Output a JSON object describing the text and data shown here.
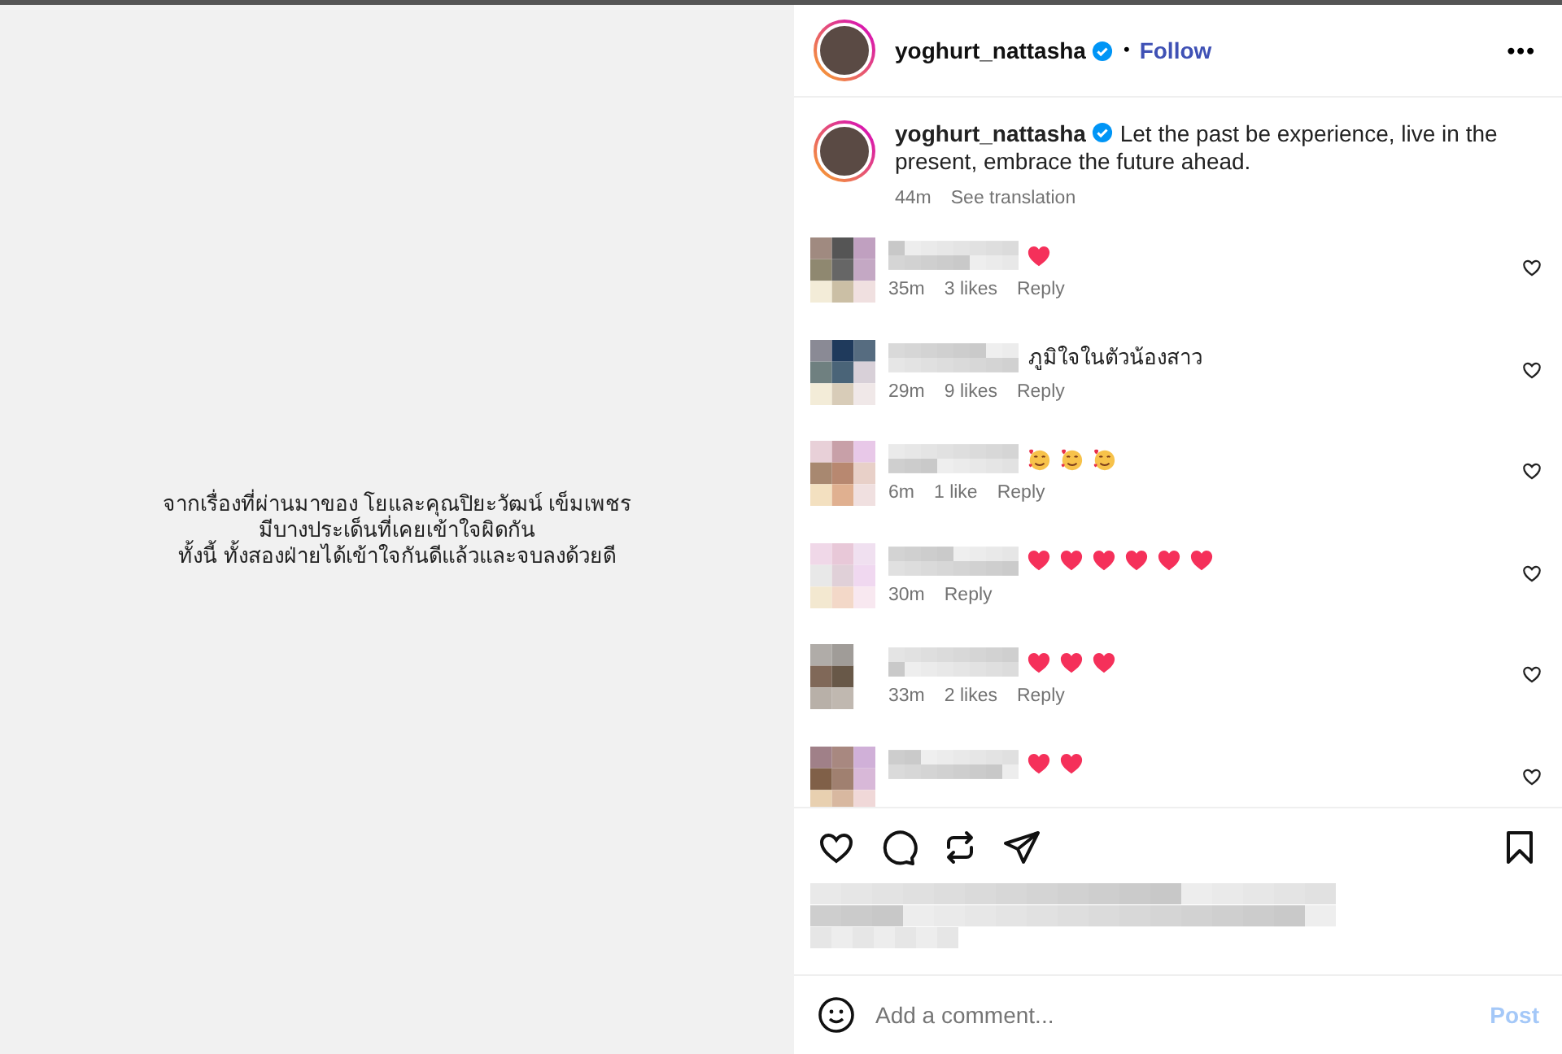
{
  "post_image": {
    "lines": [
      "จากเรื่องที่ผ่านมาของ โยและคุณปิยะวัฒน์ เข็มเพชร",
      "มีบางประเด็นที่เคยเข้าใจผิดกัน",
      "ทั้งนี้ ทั้งสองฝ่ายได้เข้าใจกันดีแล้วและจบลงด้วยดี"
    ]
  },
  "header": {
    "username": "yoghurt_nattasha",
    "verified": true,
    "separator": "•",
    "follow": "Follow",
    "more": "•••"
  },
  "caption": {
    "username": "yoghurt_nattasha",
    "verified": true,
    "text": "Let the past be experience, live in the present, embrace the future ahead.",
    "time": "44m",
    "translate": "See translation"
  },
  "comments": [
    {
      "emojis": [
        {
          "kind": "heart"
        }
      ],
      "time": "35m",
      "likes": "3 likes",
      "reply": "Reply"
    },
    {
      "text": "ภูมิใจในตัวน้องสาว",
      "time": "29m",
      "likes": "9 likes",
      "reply": "Reply"
    },
    {
      "emojis": [
        {
          "kind": "hearts-face"
        },
        {
          "kind": "hearts-face"
        },
        {
          "kind": "hearts-face"
        }
      ],
      "time": "6m",
      "likes": "1 like",
      "reply": "Reply"
    },
    {
      "emojis": [
        {
          "kind": "heart"
        },
        {
          "kind": "heart"
        },
        {
          "kind": "heart"
        },
        {
          "kind": "heart"
        },
        {
          "kind": "heart"
        },
        {
          "kind": "heart"
        }
      ],
      "time": "30m",
      "reply": "Reply"
    },
    {
      "emojis": [
        {
          "kind": "heart"
        },
        {
          "kind": "heart"
        },
        {
          "kind": "heart"
        }
      ],
      "time": "33m",
      "likes": "2 likes",
      "reply": "Reply"
    },
    {
      "emojis": [
        {
          "kind": "heart"
        },
        {
          "kind": "heart"
        }
      ]
    }
  ],
  "add_comment": {
    "placeholder": "Add a comment...",
    "post": "Post"
  }
}
